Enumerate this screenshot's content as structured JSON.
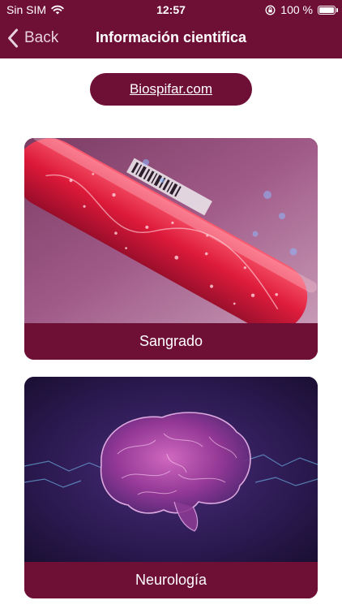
{
  "status": {
    "carrier": "Sin SIM",
    "time": "12:57",
    "battery_text": "100 %",
    "battery_level": 1.0
  },
  "nav": {
    "back_label": "Back",
    "title": "Información cientifica"
  },
  "site_link": "Biospifar.com",
  "cards": [
    {
      "label": "Sangrado",
      "image_icon": "blood-test-tube-image"
    },
    {
      "label": "Neurología",
      "image_icon": "brain-image"
    }
  ],
  "colors": {
    "brand": "#6e0f36",
    "background": "#ffffff"
  }
}
